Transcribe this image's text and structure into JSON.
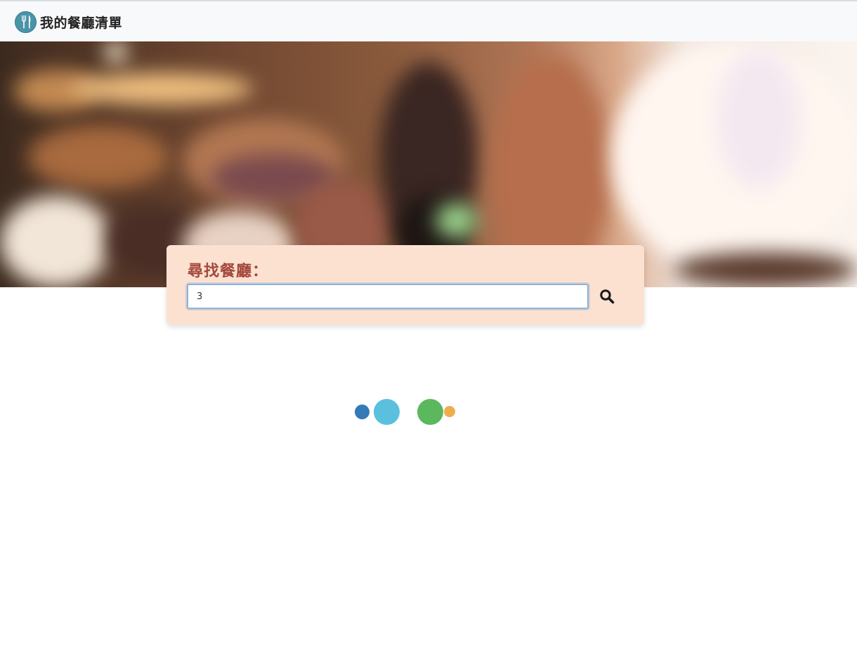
{
  "navbar": {
    "brand_icon": "fork-knife-icon",
    "brand_text": "我的餐廳清單"
  },
  "search": {
    "title": "尋找餐廳：",
    "value": "3",
    "button_icon": "search-icon"
  },
  "loader": {
    "colors": [
      "#337ab7",
      "#5bc0de",
      "#5cb85c",
      "#f0ad4e"
    ]
  }
}
